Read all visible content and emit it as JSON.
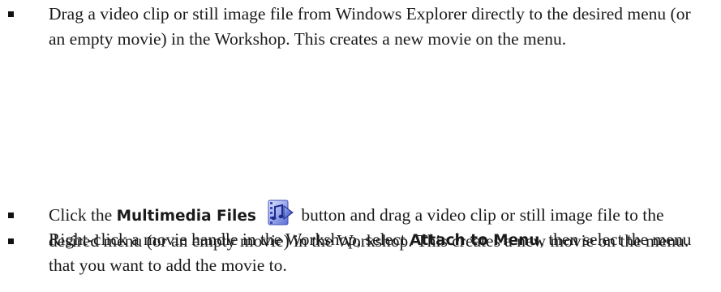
{
  "items": [
    {
      "text": "Drag a video clip or still image file from Windows Explorer directly to the desired menu (or an empty movie) in the Workshop. This creates a new movie on the menu."
    },
    {
      "pre": "Click the ",
      "strong": "Multimedia Files",
      "icon": "multimedia-files-icon",
      "post": " button and drag a video clip or still image file to the desired menu (or an empty movie) in the Workshop. This creates a new movie on the menu."
    },
    {
      "pre": "Right-click a movie handle in the Workshop, select ",
      "strong": "Attach to Menu",
      "post": ", then select the menu that you want to add the movie to."
    }
  ]
}
